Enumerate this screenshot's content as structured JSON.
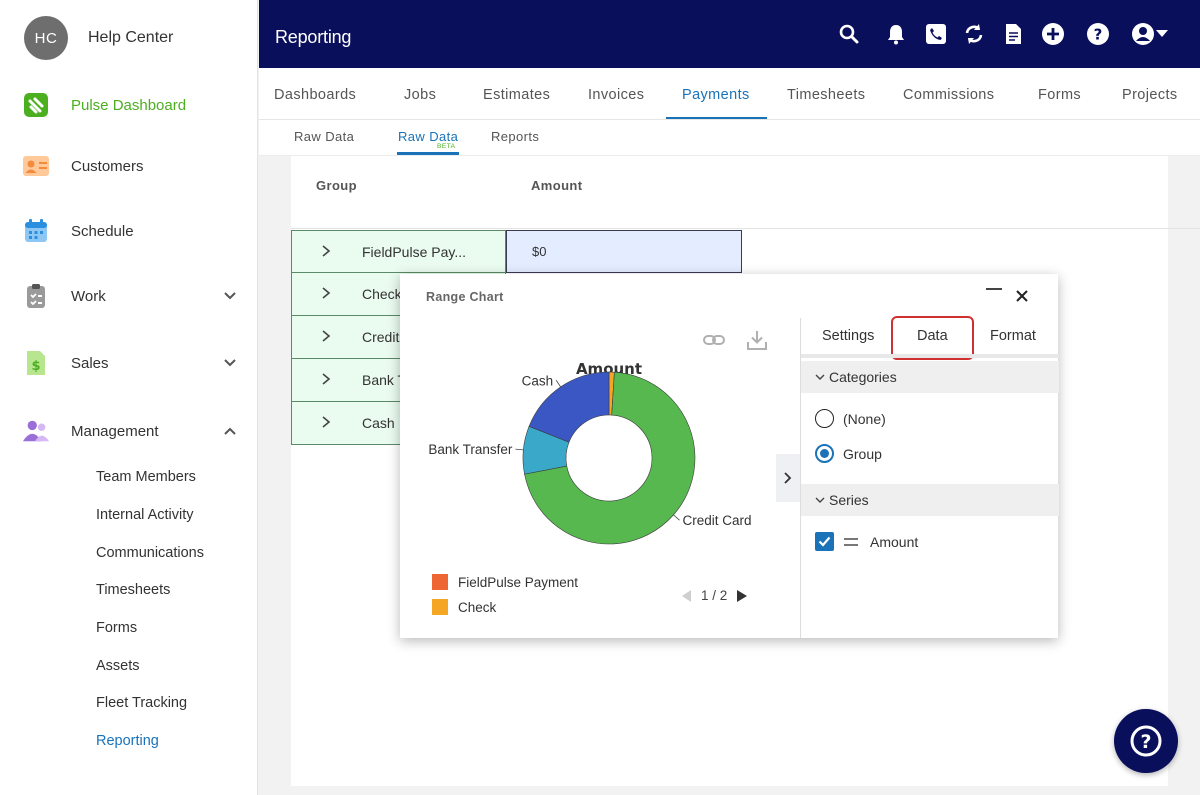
{
  "sidebar": {
    "avatar_initials": "HC",
    "brand_title": "Help Center",
    "items": [
      {
        "label": "Pulse Dashboard",
        "icon": "pulse-logo-icon"
      },
      {
        "label": "Customers",
        "icon": "contact-card-icon"
      },
      {
        "label": "Schedule",
        "icon": "calendar-icon"
      },
      {
        "label": "Work",
        "icon": "clipboard-icon"
      },
      {
        "label": "Sales",
        "icon": "dollar-document-icon"
      },
      {
        "label": "Management",
        "icon": "users-icon"
      }
    ],
    "management_sub": [
      "Team Members",
      "Internal Activity",
      "Communications",
      "Timesheets",
      "Forms",
      "Assets",
      "Fleet Tracking",
      "Reporting"
    ]
  },
  "topbar": {
    "title": "Reporting",
    "icons": [
      "search-icon",
      "bell-icon",
      "phone-icon",
      "sync-icon",
      "document-icon",
      "add-icon",
      "help-icon",
      "account-icon"
    ]
  },
  "tabs": [
    "Dashboards",
    "Jobs",
    "Estimates",
    "Invoices",
    "Payments",
    "Timesheets",
    "Commissions",
    "Forms",
    "Projects"
  ],
  "subtabs": {
    "items": [
      "Raw Data",
      "Raw Data",
      "Reports"
    ],
    "beta": "BETA"
  },
  "table": {
    "headers": {
      "group": "Group",
      "amount": "Amount"
    },
    "rows": [
      "FieldPulse Pay...",
      "Check",
      "Credit",
      "Bank T",
      "Cash"
    ],
    "first_amount": "$0"
  },
  "dialog": {
    "title": "Range Chart",
    "panel": {
      "tabs": [
        "Settings",
        "Data",
        "Format"
      ],
      "categories_label": "Categories",
      "category_options": [
        "(None)",
        "Group"
      ],
      "series_label": "Series",
      "series_item": "Amount"
    },
    "legend": [
      "FieldPulse Payment",
      "Check"
    ],
    "pager": "1 / 2"
  },
  "chart_data": {
    "type": "pie",
    "title": "Amount",
    "labels": [
      "FieldPulse Payment",
      "Check",
      "Credit Card",
      "Bank Transfer",
      "Cash"
    ],
    "values": [
      0,
      1,
      71,
      9,
      19
    ],
    "colors": [
      "#ee6633",
      "#f5a623",
      "#56b84f",
      "#3aa9c9",
      "#3a57c4"
    ],
    "visible_labels": [
      "Cash",
      "Bank Transfer",
      "Credit Card"
    ]
  },
  "colors": {
    "navbar": "#0a0f5b",
    "accent": "#1a73b8",
    "active_green": "#4caf20",
    "highlight": "#d0302f"
  }
}
